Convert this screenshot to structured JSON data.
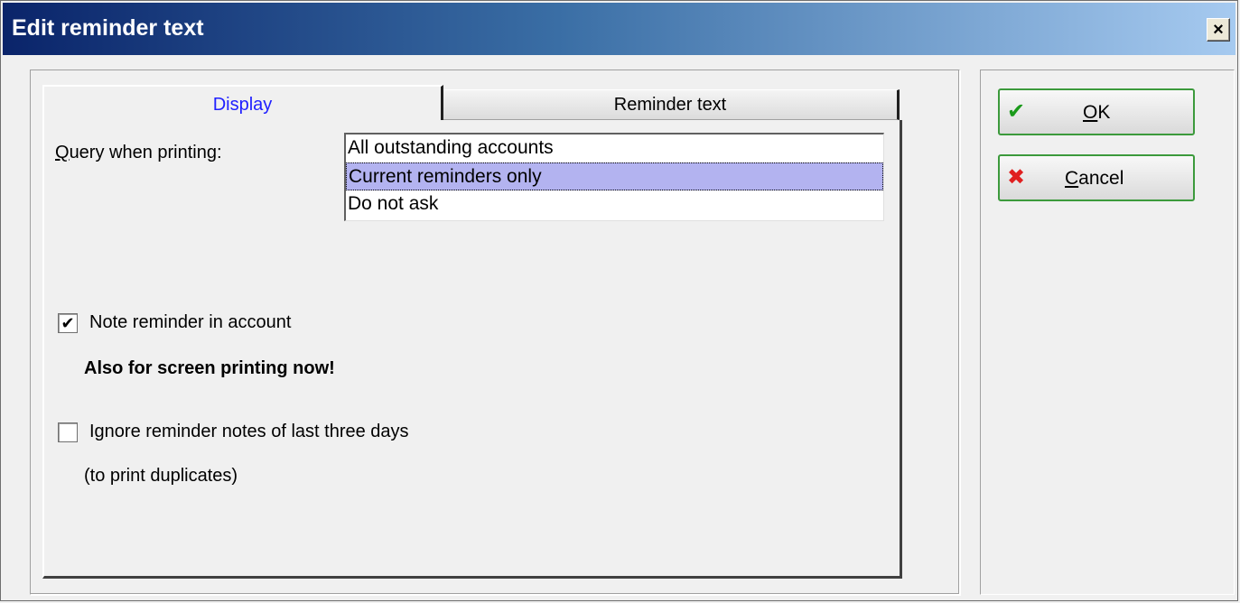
{
  "window": {
    "title": "Edit reminder text",
    "close_label": "×"
  },
  "tabs": [
    {
      "label": "Display",
      "active": true
    },
    {
      "label": "Reminder text",
      "active": false
    }
  ],
  "query": {
    "label_access_key": "Q",
    "label_rest": "uery when printing:",
    "options": [
      {
        "label": "All outstanding accounts",
        "selected": false
      },
      {
        "label": "Current reminders only",
        "selected": true
      },
      {
        "label": "Do not ask",
        "selected": false
      }
    ]
  },
  "note_reminder": {
    "label": "Note reminder in account",
    "checked": true,
    "check_mark": "✔"
  },
  "screen_printing_note": "Also for screen printing now!",
  "ignore_notes": {
    "label": "Ignore reminder notes of last three days",
    "checked": false,
    "check_mark": ""
  },
  "duplicates_note": "(to print duplicates)",
  "buttons": {
    "ok": {
      "access_key": "O",
      "rest": "K",
      "icon": "✔",
      "icon_color": "#1a9a1a"
    },
    "cancel": {
      "access_key": "C",
      "rest": "ancel",
      "icon": "✖",
      "icon_color": "#e02020"
    }
  }
}
